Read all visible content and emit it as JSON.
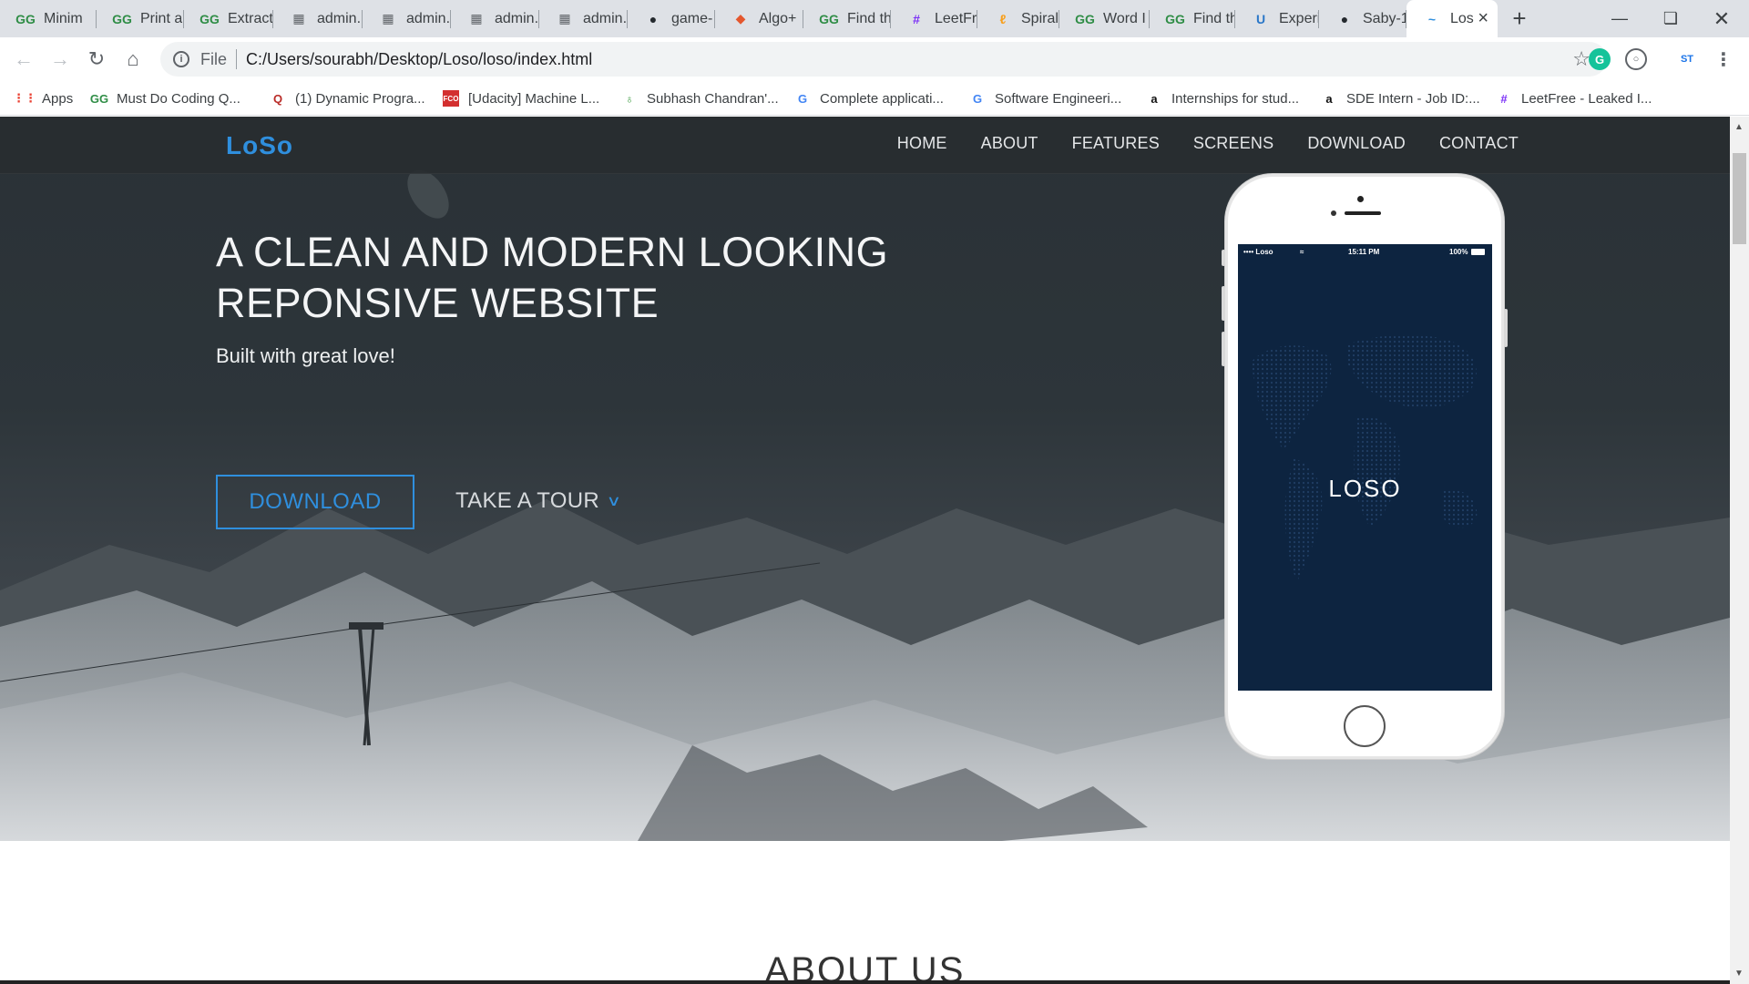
{
  "tabs": [
    {
      "title": "Minim",
      "icon": "gfg-icon",
      "glyph": "GG",
      "color": "#2f8d46"
    },
    {
      "title": "Print a",
      "icon": "gfg-icon",
      "glyph": "GG",
      "color": "#2f8d46"
    },
    {
      "title": "Extract",
      "icon": "gfg-icon",
      "glyph": "GG",
      "color": "#2f8d46"
    },
    {
      "title": "admin.",
      "icon": "admin-icon",
      "glyph": "▦",
      "color": "#5f6368"
    },
    {
      "title": "admin.",
      "icon": "admin-icon",
      "glyph": "▦",
      "color": "#5f6368"
    },
    {
      "title": "admin.",
      "icon": "admin-icon",
      "glyph": "▦",
      "color": "#5f6368"
    },
    {
      "title": "admin.",
      "icon": "admin-icon",
      "glyph": "▦",
      "color": "#5f6368"
    },
    {
      "title": "game-",
      "icon": "github-icon",
      "glyph": "●",
      "color": "#24292e"
    },
    {
      "title": "Algo+",
      "icon": "algo-icon",
      "glyph": "◆",
      "color": "#e4572e"
    },
    {
      "title": "Find th",
      "icon": "gfg-icon",
      "glyph": "GG",
      "color": "#2f8d46"
    },
    {
      "title": "LeetFre",
      "icon": "hash-icon",
      "glyph": "#",
      "color": "#7b2ff7"
    },
    {
      "title": "Spiral M",
      "icon": "leetcode-icon",
      "glyph": "ℓ",
      "color": "#f89f1b"
    },
    {
      "title": "Word I",
      "icon": "gfg-icon",
      "glyph": "GG",
      "color": "#2f8d46"
    },
    {
      "title": "Find th",
      "icon": "gfg-icon",
      "glyph": "GG",
      "color": "#2f8d46"
    },
    {
      "title": "Experie",
      "icon": "u-icon",
      "glyph": "U",
      "color": "#2a77c8"
    },
    {
      "title": "Saby-1",
      "icon": "github-icon",
      "glyph": "●",
      "color": "#24292e"
    },
    {
      "title": "Los",
      "icon": "loso-icon",
      "glyph": "~",
      "color": "#2f8fde"
    }
  ],
  "toolbar": {
    "info_glyph": "i",
    "file_label": "File",
    "url": "C:/Users/sourabh/Desktop/Loso/loso/index.html"
  },
  "bookmarks": [
    {
      "label": "Apps",
      "icon": "apps-icon",
      "glyph": "⋮⋮",
      "color": "#ea4335"
    },
    {
      "label": "Must Do Coding Q...",
      "icon": "gfg-icon",
      "glyph": "GG",
      "color": "#2f8d46"
    },
    {
      "label": "(1) Dynamic Progra...",
      "icon": "quora-icon",
      "glyph": "Q",
      "color": "#b92b27"
    },
    {
      "label": "[Udacity] Machine L...",
      "icon": "fco-icon",
      "glyph": "FCO",
      "color": "#d32f2f"
    },
    {
      "label": "Subhash Chandran'...",
      "icon": "leaf-icon",
      "glyph": "♁",
      "color": "#43a047"
    },
    {
      "label": "Complete applicati...",
      "icon": "google-icon",
      "glyph": "G",
      "color": "#4285f4"
    },
    {
      "label": "Software Engineeri...",
      "icon": "google-icon",
      "glyph": "G",
      "color": "#4285f4"
    },
    {
      "label": "Internships for stud...",
      "icon": "amazon-icon",
      "glyph": "a",
      "color": "#111111"
    },
    {
      "label": "SDE Intern - Job ID:...",
      "icon": "amazon-icon",
      "glyph": "a",
      "color": "#111111"
    },
    {
      "label": "LeetFree - Leaked I...",
      "icon": "hash-icon",
      "glyph": "#",
      "color": "#7b2ff7"
    }
  ],
  "site": {
    "logo": "LoSo",
    "nav": [
      "HOME",
      "ABOUT",
      "FEATURES",
      "SCREENS",
      "DOWNLOAD",
      "CONTACT"
    ],
    "headline": "A CLEAN AND MODERN LOOKING REPONSIVE WEBSITE",
    "subheadline": "Built with great love!",
    "download_label": "DOWNLOAD",
    "tour_label": "TAKE A TOUR",
    "phone": {
      "carrier": "•••• Loso",
      "time": "15:11 PM",
      "battery": "100%",
      "screen_logo": "LOSO"
    },
    "about_heading": "ABOUT US"
  },
  "colors": {
    "accent": "#2f8fde",
    "phone_screen": "#0d2440"
  }
}
